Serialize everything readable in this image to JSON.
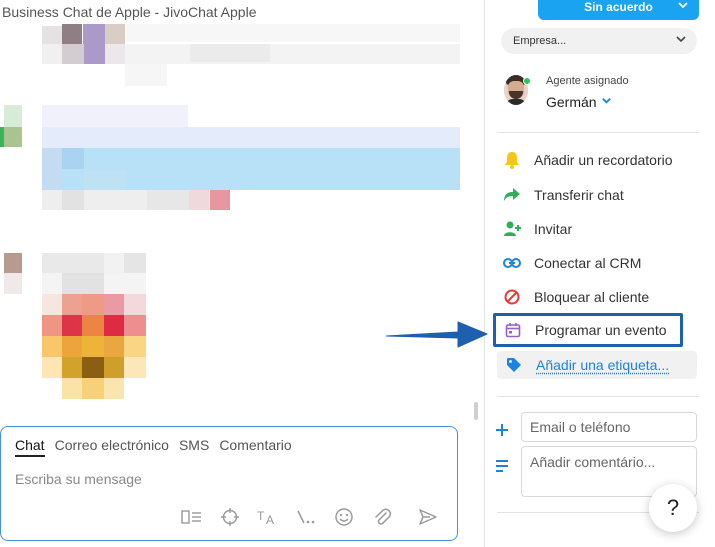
{
  "chat": {
    "title": "Business Chat de Apple - JivoChat Apple",
    "composer": {
      "tabs": [
        "Chat",
        "Correo electrónico",
        "SMS",
        "Comentario"
      ],
      "active_tab": "Chat",
      "placeholder": "Escriba su mensage",
      "tools": [
        {
          "icon": "templates-icon",
          "glyph": "▯≡"
        },
        {
          "icon": "target-icon",
          "glyph": "⌖"
        },
        {
          "icon": "translate-icon",
          "glyph": "ᵀA"
        },
        {
          "icon": "shortcuts-icon",
          "glyph": "\\.."
        },
        {
          "icon": "emoji-icon",
          "glyph": "☺"
        },
        {
          "icon": "attach-icon",
          "glyph": "✐"
        }
      ],
      "send_icon": "send-icon"
    }
  },
  "side": {
    "status_button": "Sin acuerdo",
    "company_select": "Empresa...",
    "agent_caption": "Agente asignado",
    "agent_name": "Germán",
    "actions": [
      {
        "label": "Añadir un recordatorio",
        "icon": "bell-icon",
        "color": "#f5c518"
      },
      {
        "label": "Transferir chat",
        "icon": "forward-icon",
        "color": "#2eaf58"
      },
      {
        "label": "Invitar",
        "icon": "add-person-icon",
        "color": "#2eaf58"
      },
      {
        "label": "Conectar al CRM",
        "icon": "link-icon",
        "color": "#1a84e0"
      },
      {
        "label": "Bloquear al cliente",
        "icon": "block-icon",
        "color": "#e53935"
      },
      {
        "label": "Programar un evento",
        "icon": "calendar-icon",
        "color": "#9b5fc0"
      },
      {
        "label": "Añadir una etiqueta...",
        "icon": "tag-icon",
        "color": "#1a84e0"
      }
    ],
    "contact_placeholder": "Email o teléfono",
    "comment_placeholder": "Añadir comentário...",
    "help_label": "?"
  },
  "colors": {
    "accent": "#1aa3f0",
    "highlight_border": "#1f5fb0",
    "link": "#1a84e0"
  }
}
